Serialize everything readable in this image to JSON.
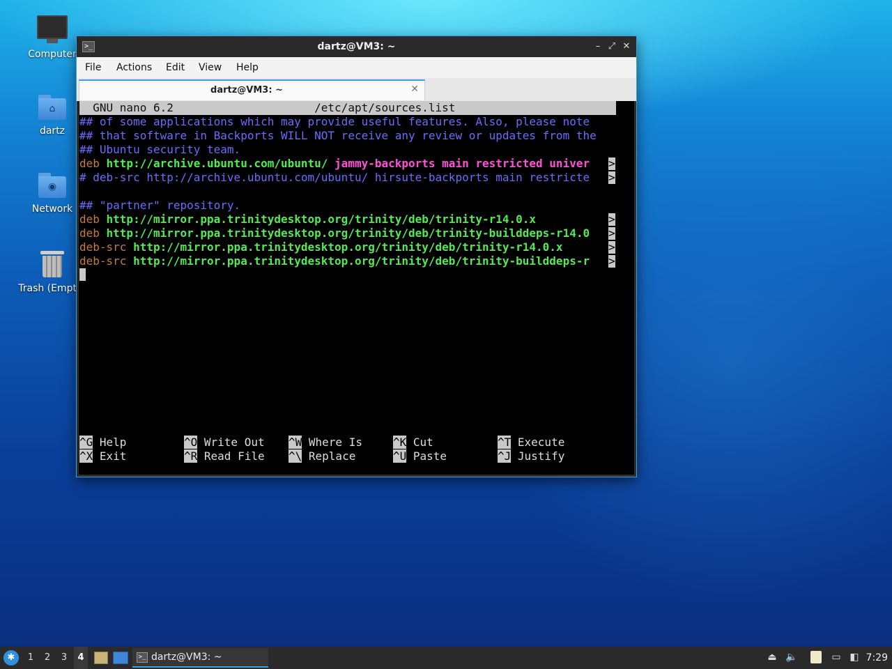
{
  "desktop": {
    "icons": [
      {
        "label": "Computer",
        "icon": "computer-icon"
      },
      {
        "label": "dartz",
        "icon": "home-folder-icon"
      },
      {
        "label": "Network",
        "icon": "network-folder-icon"
      },
      {
        "label": "Trash (Empty)",
        "icon": "trash-icon"
      }
    ]
  },
  "window": {
    "title": "dartz@VM3: ~",
    "controls": {
      "minimize": "–",
      "maximize": "⤢",
      "close": "✕"
    },
    "menu": [
      "File",
      "Actions",
      "Edit",
      "View",
      "Help"
    ],
    "tab": {
      "label": "dartz@VM3: ~",
      "close": "✕"
    }
  },
  "nano": {
    "header": "  GNU nano 6.2                     /etc/apt/sources.list",
    "lines": [
      {
        "parts": [
          {
            "t": "## of some applications which may provide useful features. Also, please note",
            "c": "c-blue"
          }
        ]
      },
      {
        "parts": [
          {
            "t": "## that software in Backports WILL NOT receive any review or updates from the",
            "c": "c-blue"
          }
        ]
      },
      {
        "parts": [
          {
            "t": "## Ubuntu security team.",
            "c": "c-blue"
          }
        ]
      },
      {
        "parts": [
          {
            "t": "deb ",
            "c": "c-orange"
          },
          {
            "t": "http://archive.ubuntu.com/ubuntu/ ",
            "c": "c-green"
          },
          {
            "t": "jammy-backports main restricted univer",
            "c": "c-magenta"
          }
        ],
        "mark": ">"
      },
      {
        "parts": [
          {
            "t": "# deb-src http://archive.ubuntu.com/ubuntu/ hirsute-backports main restricte",
            "c": "c-blue"
          }
        ],
        "mark": ">"
      },
      {
        "parts": [
          {
            "t": "",
            "c": ""
          }
        ]
      },
      {
        "parts": [
          {
            "t": "## \"partner\" repository.",
            "c": "c-blue"
          }
        ]
      },
      {
        "parts": [
          {
            "t": "deb ",
            "c": "c-orange"
          },
          {
            "t": "http://mirror.ppa.trinitydesktop.org/trinity/deb/trinity-r14.0.x",
            "c": "c-green2"
          }
        ],
        "mark": ">"
      },
      {
        "parts": [
          {
            "t": "deb ",
            "c": "c-orange"
          },
          {
            "t": "http://mirror.ppa.trinitydesktop.org/trinity/deb/trinity-builddeps-r14.0",
            "c": "c-green2"
          }
        ],
        "mark": ">"
      },
      {
        "parts": [
          {
            "t": "deb-src ",
            "c": "c-orange"
          },
          {
            "t": "http://mirror.ppa.trinitydesktop.org/trinity/deb/trinity-r14.0.x",
            "c": "c-green2"
          }
        ],
        "mark": ">"
      },
      {
        "parts": [
          {
            "t": "deb-src ",
            "c": "c-orange"
          },
          {
            "t": "http://mirror.ppa.trinitydesktop.org/trinity/deb/trinity-builddeps-r",
            "c": "c-green2"
          }
        ],
        "mark": ">"
      }
    ],
    "shortcuts": [
      {
        "key": "^G",
        "label": " Help"
      },
      {
        "key": "^O",
        "label": " Write Out"
      },
      {
        "key": "^W",
        "label": " Where Is"
      },
      {
        "key": "^K",
        "label": " Cut"
      },
      {
        "key": "^T",
        "label": " Execute"
      },
      {
        "key": "^X",
        "label": " Exit"
      },
      {
        "key": "^R",
        "label": " Read File"
      },
      {
        "key": "^\\",
        "label": " Replace"
      },
      {
        "key": "^U",
        "label": " Paste"
      },
      {
        "key": "^J",
        "label": " Justify"
      }
    ]
  },
  "taskbar": {
    "workspaces": [
      "1",
      "2",
      "3",
      "4"
    ],
    "active_workspace": "4",
    "task_label": "dartz@VM3: ~",
    "clock": "7:29"
  }
}
